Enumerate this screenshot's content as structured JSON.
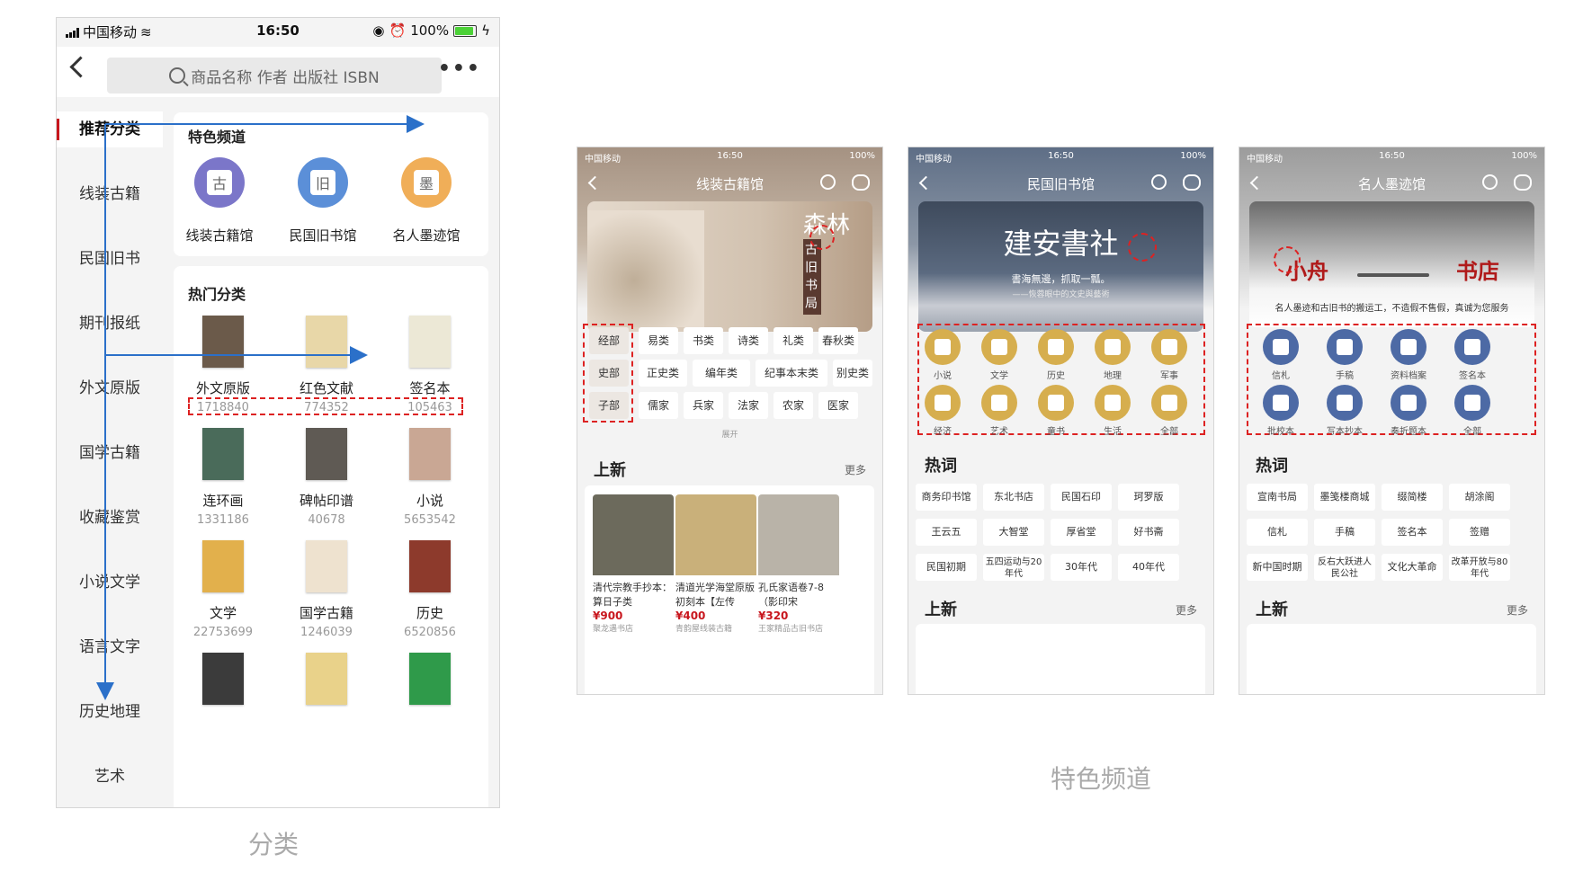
{
  "main": {
    "status": {
      "carrier": "中国移动",
      "time": "16:50",
      "battery": "100%"
    },
    "search_placeholder": "商品名称 作者 出版社 ISBN",
    "more": "•••",
    "nav": [
      "推荐分类",
      "线装古籍",
      "民国旧书",
      "期刊报纸",
      "外文原版",
      "国学古籍",
      "收藏鉴赏",
      "小说文学",
      "语言文字",
      "历史地理",
      "艺术"
    ],
    "featured_title": "特色频道",
    "featured": [
      {
        "label": "线装古籍馆",
        "glyph": "古",
        "color": "#7b76c9"
      },
      {
        "label": "民国旧书馆",
        "glyph": "旧",
        "color": "#5b8fd8"
      },
      {
        "label": "名人墨迹馆",
        "glyph": "墨",
        "color": "#f0ae58"
      }
    ],
    "hot_title": "热门分类",
    "categories": [
      {
        "name": "外文原版",
        "count": "1718840",
        "cover": "#6b5a4a"
      },
      {
        "name": "红色文献",
        "count": "774352",
        "cover": "#e8d7a8"
      },
      {
        "name": "签名本",
        "count": "105463",
        "cover": "#ece8d6"
      },
      {
        "name": "连环画",
        "count": "1331186",
        "cover": "#4a6b5a"
      },
      {
        "name": "碑帖印谱",
        "count": "40678",
        "cover": "#5f5a54"
      },
      {
        "name": "小说",
        "count": "5653542",
        "cover": "#c9a794"
      },
      {
        "name": "文学",
        "count": "22753699",
        "cover": "#e2b04c"
      },
      {
        "name": "国学古籍",
        "count": "1246039",
        "cover": "#eee2cf"
      },
      {
        "name": "历史",
        "count": "6520856",
        "cover": "#8d3a2c"
      },
      {
        "name": "",
        "count": "",
        "cover": "#3b3b3b"
      },
      {
        "name": "",
        "count": "",
        "cover": "#e9d28a"
      },
      {
        "name": "",
        "count": "",
        "cover": "#2f9a4a"
      }
    ]
  },
  "captions": {
    "left": "分类",
    "right": "特色频道"
  },
  "mini1": {
    "title": "线装古籍馆",
    "banner_big": "森林",
    "banner_sub": "古旧书局",
    "left_tags": [
      "经部",
      "史部",
      "子部"
    ],
    "row1": [
      "易类",
      "书类",
      "诗类",
      "礼类",
      "春秋类"
    ],
    "row2": [
      "正史类",
      "编年类",
      "纪事本末类",
      "别史类"
    ],
    "row3": [
      "儒家",
      "兵家",
      "法家",
      "农家",
      "医家"
    ],
    "expand": "展开",
    "new_title": "上新",
    "more": "更多",
    "products": [
      {
        "title": "清代宗教手抄本：算日子类",
        "price": "¥900",
        "shop": "聚龙遇书店",
        "color": "#6c6a5c"
      },
      {
        "title": "清道光学海堂原版初刻本【左传",
        "price": "¥400",
        "shop": "青韵屋线装古籍",
        "color": "#c9b07a"
      },
      {
        "title": "孔氏家语卷7-8（影印宋",
        "price": "¥320",
        "shop": "王家精品古旧书店",
        "color": "#b9b3a8"
      }
    ]
  },
  "mini2": {
    "title": "民国旧书馆",
    "banner_big": "建安書社",
    "banner_sub": "書海無邊，抓取一瓢。",
    "banner_sub2": "——恢蓉眼中的文史與藝術",
    "icons": [
      "小说",
      "文学",
      "历史",
      "地理",
      "军事",
      "经济",
      "艺术",
      "童书",
      "生活",
      "全部"
    ],
    "hot_title": "热词",
    "hot": [
      "商务印书馆",
      "东北书店",
      "民国石印",
      "珂罗版",
      "王云五",
      "大智堂",
      "厚省堂",
      "好书斋",
      "民国初期",
      "五四运动与20年代",
      "30年代",
      "40年代"
    ],
    "new_title": "上新",
    "more": "更多"
  },
  "mini3": {
    "title": "名人墨迹馆",
    "banner_a": "小舟",
    "banner_b": "书店",
    "banner_sub": "名人墨迹和古旧书的搬运工，不造假不售假，真诚为您服务",
    "icons": [
      "信札",
      "手稿",
      "资料档案",
      "签名本",
      "批校本",
      "写本抄本",
      "奏折题本",
      "全部"
    ],
    "hot_title": "热词",
    "hot": [
      "宣南书局",
      "墨笺楼商城",
      "缀简楼",
      "胡涂阁",
      "信札",
      "手稿",
      "签名本",
      "签赠",
      "新中国时期",
      "反右大跃进人民公社",
      "文化大革命",
      "改革开放与80年代"
    ],
    "new_title": "上新",
    "more": "更多"
  }
}
